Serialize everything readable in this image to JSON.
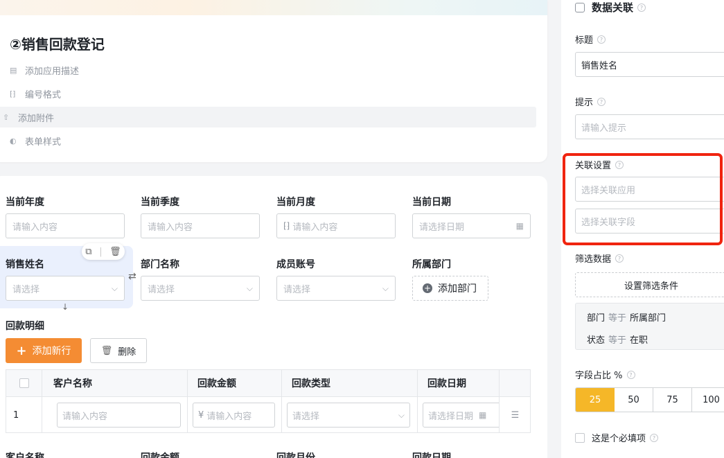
{
  "form": {
    "title": "②销售回款登记",
    "meta": [
      {
        "icon": "description-icon",
        "glyph": "▤",
        "label": "添加应用描述"
      },
      {
        "icon": "number-format-icon",
        "glyph": "⁅⁆",
        "label": "编号格式"
      },
      {
        "icon": "upload-icon",
        "glyph": "⇧",
        "label": "添加附件"
      },
      {
        "icon": "palette-icon",
        "glyph": "◐",
        "label": "表单样式"
      }
    ]
  },
  "fields": {
    "year": {
      "label": "当前年度",
      "placeholder": "请输入内容"
    },
    "quarter": {
      "label": "当前季度",
      "placeholder": "请输入内容"
    },
    "month": {
      "label": "当前月度",
      "placeholder": "请输入内容"
    },
    "date": {
      "label": "当前日期",
      "placeholder": "请选择日期"
    },
    "salesName": {
      "label": "销售姓名",
      "placeholder": "请选择"
    },
    "deptName": {
      "label": "部门名称",
      "placeholder": "请选择"
    },
    "account": {
      "label": "成员账号",
      "placeholder": "请选择"
    },
    "dept": {
      "label": "所属部门",
      "button": "添加部门"
    }
  },
  "subtable": {
    "title": "回款明细",
    "add_label": "添加新行",
    "delete_label": "删除",
    "columns": [
      "客户名称",
      "回款金额",
      "回款类型",
      "回款日期"
    ],
    "row": {
      "index": "1",
      "customer_placeholder": "请输入内容",
      "amount_prefix": "¥",
      "amount_placeholder": "请输入内容",
      "type_placeholder": "请选择",
      "date_placeholder": "请选择日期"
    }
  },
  "bottom_labels": [
    "客户名称",
    "回款金额",
    "回款月份",
    "回款日期"
  ],
  "panel": {
    "title": "数据关联",
    "title_label": "标题",
    "title_value": "销售姓名",
    "hint_label": "提示",
    "hint_placeholder": "请输入提示",
    "link_label": "关联设置",
    "link_app_placeholder": "选择关联应用",
    "link_field_placeholder": "选择关联字段",
    "filter_label": "筛选数据",
    "filter_button": "设置筛选条件",
    "conditions": [
      {
        "field": "部门",
        "op": "等于",
        "value": "所属部门"
      },
      {
        "field": "状态",
        "op": "等于",
        "value": "在职"
      }
    ],
    "ratio_label": "字段占比 %",
    "ratios": [
      "25",
      "50",
      "75",
      "100"
    ],
    "ratio_selected": "25",
    "required_label": "这是个必填项"
  },
  "colors": {
    "accent": "#f48c33",
    "segment_active": "#f5b728",
    "highlight_box": "#f0240f",
    "selected_field_bg": "#eaf0fd"
  }
}
